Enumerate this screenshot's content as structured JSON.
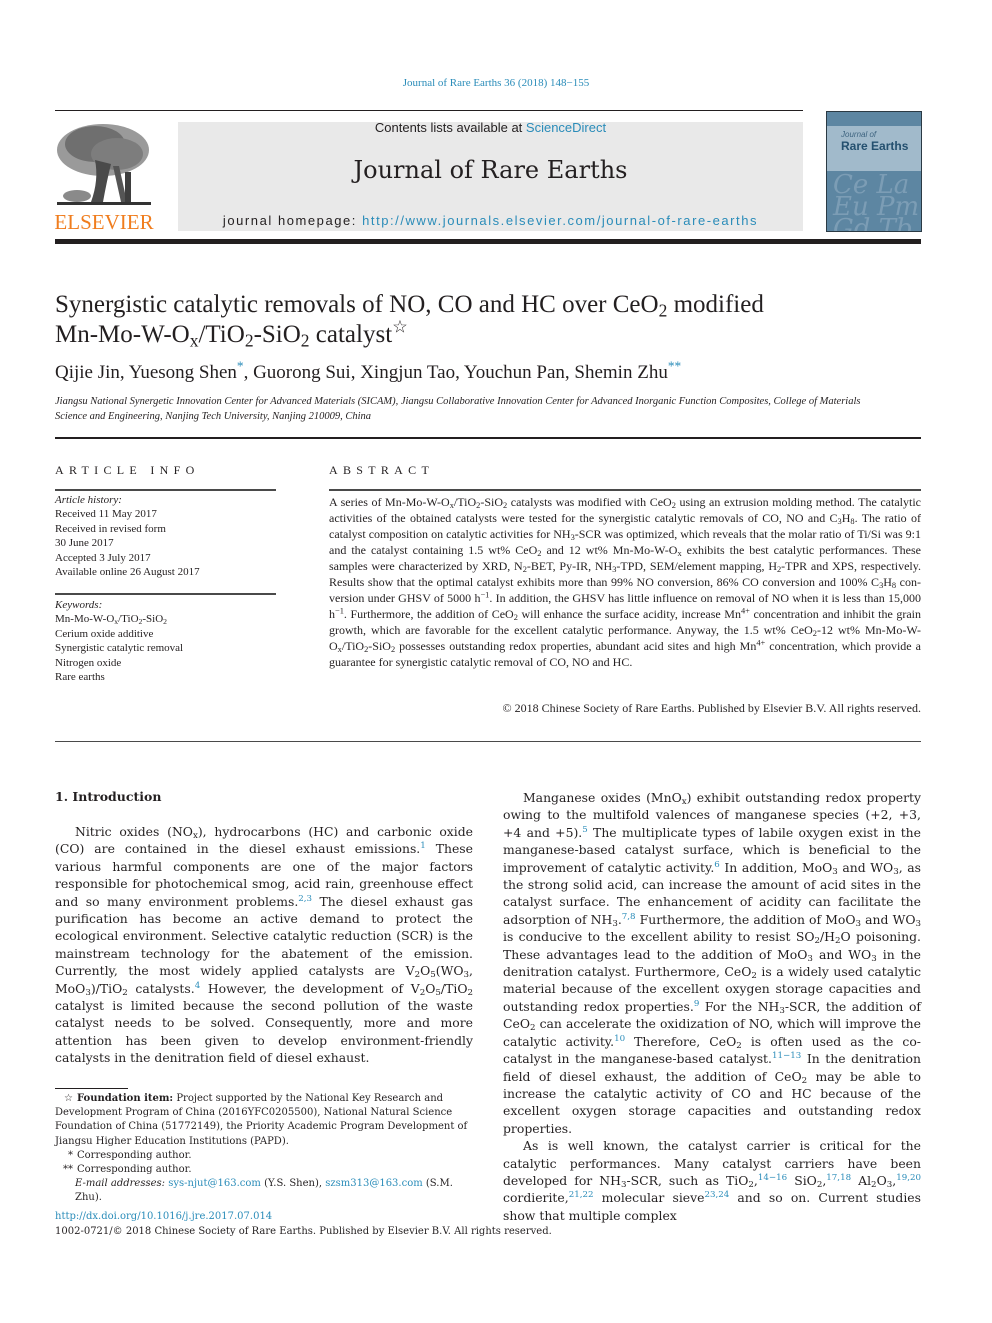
{
  "running_head": "Journal of Rare Earths 36 (2018) 148−155",
  "masthead": {
    "publisher_logo_text": "ELSEVIER",
    "contents_prefix": "Contents lists available at ",
    "contents_link": "ScienceDirect",
    "journal_name": "Journal of Rare Earths",
    "homepage_label": "journal homepage: ",
    "homepage_url": "http://www.journals.elsevier.com/journal-of-rare-earths",
    "cover": {
      "small_title": "Journal of",
      "big_title": "Rare Earths",
      "bg_letters": "Ce La Eu Pm Gd Tb"
    }
  },
  "article": {
    "title_lines": [
      [
        {
          "t": "Synergistic catalytic removals of NO, CO and HC over CeO"
        },
        {
          "t": "2",
          "sub": true
        },
        {
          "t": " modified"
        }
      ],
      [
        {
          "t": "Mn-Mo-W-O"
        },
        {
          "t": "x",
          "sub": true
        },
        {
          "t": "/TiO"
        },
        {
          "t": "2",
          "sub": true
        },
        {
          "t": "-SiO"
        },
        {
          "t": "2",
          "sub": true
        },
        {
          "t": " catalyst"
        },
        {
          "t": "☆",
          "sup": true
        }
      ]
    ],
    "authors": [
      [
        {
          "t": "Qijie Jin, Yuesong Shen"
        },
        {
          "t": "*",
          "sup": true,
          "ref": true
        },
        {
          "t": ", Guorong Sui, Xingjun Tao, Youchun Pan, Shemin Zhu"
        },
        {
          "t": "**",
          "sup": true,
          "ref": true
        }
      ]
    ],
    "affiliation": "Jiangsu National Synergetic Innovation Center for Advanced Materials (SICAM), Jiangsu Collaborative Innovation Center for Advanced Inorganic Function Composites, College of Materials Science and Engineering, Nanjing Tech University, Nanjing 210009, China"
  },
  "article_info": {
    "heading": "ARTICLE INFO",
    "history_label": "Article history:",
    "history": [
      "Received 11 May 2017",
      "Received in revised form",
      "30 June 2017",
      "Accepted 3 July 2017",
      "Available online 26 August 2017"
    ],
    "keywords_label": "Keywords:",
    "keywords": [
      [
        {
          "t": "Mn-Mo-W-O"
        },
        {
          "t": "x",
          "sub": true
        },
        {
          "t": "/TiO"
        },
        {
          "t": "2",
          "sub": true
        },
        {
          "t": "-SiO"
        },
        {
          "t": "2",
          "sub": true
        }
      ],
      [
        {
          "t": "Cerium oxide additive"
        }
      ],
      [
        {
          "t": "Synergistic catalytic removal"
        }
      ],
      [
        {
          "t": "Nitrogen oxide"
        }
      ],
      [
        {
          "t": "Rare earths"
        }
      ]
    ]
  },
  "abstract": {
    "heading": "ABSTRACT",
    "paragraphs": [
      [
        {
          "t": "A series of Mn-Mo-W-O"
        },
        {
          "t": "x",
          "sub": true
        },
        {
          "t": "/TiO"
        },
        {
          "t": "2",
          "sub": true
        },
        {
          "t": "-SiO"
        },
        {
          "t": "2",
          "sub": true
        },
        {
          "t": " catalysts was modified with CeO"
        },
        {
          "t": "2",
          "sub": true
        },
        {
          "t": " using an extrusion molding method. The catalytic activities of the obtained catalysts were tested for the synergistic catalytic re­movals of CO, NO and C"
        },
        {
          "t": "3",
          "sub": true
        },
        {
          "t": "H"
        },
        {
          "t": "8",
          "sub": true
        },
        {
          "t": ". The ratio of catalyst composition on catalytic activities for NH"
        },
        {
          "t": "3",
          "sub": true
        },
        {
          "t": "-SCR was optimized, which reveals that the molar ratio of Ti/Si was 9:1 and the catalyst containing 1.5 wt% CeO"
        },
        {
          "t": "2",
          "sub": true
        },
        {
          "t": " and 12 wt% Mn-Mo-W-O"
        },
        {
          "t": "x",
          "sub": true
        },
        {
          "t": " exhibits the best catalytic performances. These samples were characterized by XRD, N"
        },
        {
          "t": "2",
          "sub": true
        },
        {
          "t": "-BET, Py-IR, NH"
        },
        {
          "t": "3",
          "sub": true
        },
        {
          "t": "-TPD, SEM/element mapping, H"
        },
        {
          "t": "2",
          "sub": true
        },
        {
          "t": "-TPR and XPS, respectively. Results show that the optimal catalyst exhibits more than 99% NO conversion, 86% CO conversion and 100% C"
        },
        {
          "t": "3",
          "sub": true
        },
        {
          "t": "H"
        },
        {
          "t": "8",
          "sub": true
        },
        {
          "t": " con­version under GHSV of 5000 h"
        },
        {
          "t": "−1",
          "sup": true
        },
        {
          "t": ". In addition, the GHSV has little influence on removal of NO when it is less than 15,000 h"
        },
        {
          "t": "−1",
          "sup": true
        },
        {
          "t": ". Furthermore, the addition of CeO"
        },
        {
          "t": "2",
          "sub": true
        },
        {
          "t": " will enhance the surface acidity, increase Mn"
        },
        {
          "t": "4+",
          "sup": true
        },
        {
          "t": " concentration and inhibit the grain growth, which are favorable for the excellent catalytic performance. Anyway, the 1.5 wt% CeO"
        },
        {
          "t": "2",
          "sub": true
        },
        {
          "t": "-12 wt% Mn-Mo-W-O"
        },
        {
          "t": "x",
          "sub": true
        },
        {
          "t": "/TiO"
        },
        {
          "t": "2",
          "sub": true
        },
        {
          "t": "-SiO"
        },
        {
          "t": "2",
          "sub": true
        },
        {
          "t": " possesses outstanding redox properties, abundant acid sites and high Mn"
        },
        {
          "t": "4+",
          "sup": true
        },
        {
          "t": " concentration, which provide a guarantee for synergistic catalytic removal of CO, NO and HC."
        }
      ]
    ],
    "copyright": "© 2018 Chinese Society of Rare Earths. Published by Elsevier B.V. All rights reserved."
  },
  "body": {
    "section_heading": "1.  Introduction",
    "left_paragraphs": [
      [
        {
          "t": "Nitric oxides (NO"
        },
        {
          "t": "x",
          "sub": true
        },
        {
          "t": "), hydrocarbons (HC) and carbonic oxide (CO) are contained in the diesel exhaust emissions."
        },
        {
          "t": "1",
          "sup": true,
          "ref": true
        },
        {
          "t": " These various harmful components are one of the major factors responsible for photochemical smog, acid rain, greenhouse effect and so many environment problems."
        },
        {
          "t": "2,3",
          "sup": true,
          "ref": true
        },
        {
          "t": " The diesel exhaust gas purification has become an active demand to protect the ecological environment. Selective catalytic reduction (SCR) is the mainstream technology for the abatement of the emission. Currently, the most widely applied catalysts are V"
        },
        {
          "t": "2",
          "sub": true
        },
        {
          "t": "O"
        },
        {
          "t": "5",
          "sub": true
        },
        {
          "t": "(WO"
        },
        {
          "t": "3",
          "sub": true
        },
        {
          "t": ", MoO"
        },
        {
          "t": "3",
          "sub": true
        },
        {
          "t": ")/TiO"
        },
        {
          "t": "2",
          "sub": true
        },
        {
          "t": " catalysts."
        },
        {
          "t": "4",
          "sup": true,
          "ref": true
        },
        {
          "t": " However, the development of V"
        },
        {
          "t": "2",
          "sub": true
        },
        {
          "t": "O"
        },
        {
          "t": "5",
          "sub": true
        },
        {
          "t": "/TiO"
        },
        {
          "t": "2",
          "sub": true
        },
        {
          "t": " catalyst is limited because the second pollution of the waste catalyst needs to be solved. Consequently, more and more attention has been given to develop environment-friendly catalysts in the denitration field of diesel exhaust."
        }
      ]
    ],
    "right_paragraphs": [
      [
        {
          "t": "Manganese oxides (MnO"
        },
        {
          "t": "x",
          "sub": true
        },
        {
          "t": ") exhibit outstanding redox property owing to the multifold valences of manganese species (+2, +3, +4 and +5)."
        },
        {
          "t": "5",
          "sup": true,
          "ref": true
        },
        {
          "t": " The multiplicate types of labile oxygen exist in the manganese-based catalyst surface, which is beneficial to the improvement of catalytic activity."
        },
        {
          "t": "6",
          "sup": true,
          "ref": true
        },
        {
          "t": " In addition, MoO"
        },
        {
          "t": "3",
          "sub": true
        },
        {
          "t": " and WO"
        },
        {
          "t": "3",
          "sub": true
        },
        {
          "t": ", as the strong solid acid, can increase the amount of acid sites in the catalyst surface. The enhancement of acidity can facilitate the adsorption of NH"
        },
        {
          "t": "3",
          "sub": true
        },
        {
          "t": "."
        },
        {
          "t": "7,8",
          "sup": true,
          "ref": true
        },
        {
          "t": " Furthermore, the addition of MoO"
        },
        {
          "t": "3",
          "sub": true
        },
        {
          "t": " and WO"
        },
        {
          "t": "3",
          "sub": true
        },
        {
          "t": " is conducive to the excellent ability to resist SO"
        },
        {
          "t": "2",
          "sub": true
        },
        {
          "t": "/H"
        },
        {
          "t": "2",
          "sub": true
        },
        {
          "t": "O poisoning. These advantages lead to the addition of MoO"
        },
        {
          "t": "3",
          "sub": true
        },
        {
          "t": " and WO"
        },
        {
          "t": "3",
          "sub": true
        },
        {
          "t": " in the denitration catalyst. Furthermore, CeO"
        },
        {
          "t": "2",
          "sub": true
        },
        {
          "t": " is a widely used catalytic material because of the excellent oxygen storage capacities and outstanding redox properties."
        },
        {
          "t": "9",
          "sup": true,
          "ref": true
        },
        {
          "t": " For the NH"
        },
        {
          "t": "3",
          "sub": true
        },
        {
          "t": "-SCR, the addition of CeO"
        },
        {
          "t": "2",
          "sub": true
        },
        {
          "t": " can accelerate the oxidization of NO, which will improve the catalytic activity."
        },
        {
          "t": "10",
          "sup": true,
          "ref": true
        },
        {
          "t": " Therefore, CeO"
        },
        {
          "t": "2",
          "sub": true
        },
        {
          "t": " is often used as the co-catalyst in the manganese-based catalyst."
        },
        {
          "t": "11−13",
          "sup": true,
          "ref": true
        },
        {
          "t": " In the denitration field of diesel exhaust, the addition of CeO"
        },
        {
          "t": "2",
          "sub": true
        },
        {
          "t": " may be able to increase the catalytic activity of CO and HC because of the excellent oxygen storage capacities and outstanding redox properties."
        }
      ],
      [
        {
          "t": "As is well known, the catalyst carrier is critical for the catalytic performances. Many catalyst carriers have been developed for NH"
        },
        {
          "t": "3",
          "sub": true
        },
        {
          "t": "-SCR, such as TiO"
        },
        {
          "t": "2",
          "sub": true
        },
        {
          "t": ","
        },
        {
          "t": "14−16",
          "sup": true,
          "ref": true
        },
        {
          "t": " SiO"
        },
        {
          "t": "2",
          "sub": true
        },
        {
          "t": ","
        },
        {
          "t": "17,18",
          "sup": true,
          "ref": true
        },
        {
          "t": " Al"
        },
        {
          "t": "2",
          "sub": true
        },
        {
          "t": "O"
        },
        {
          "t": "3",
          "sub": true
        },
        {
          "t": ","
        },
        {
          "t": "19,20",
          "sup": true,
          "ref": true
        },
        {
          "t": " cordierite,"
        },
        {
          "t": "21,22",
          "sup": true,
          "ref": true
        },
        {
          "t": " molecular sieve"
        },
        {
          "t": "23,24",
          "sup": true,
          "ref": true
        },
        {
          "t": " and so on. Current studies show that multiple complex"
        }
      ]
    ]
  },
  "footnotes": {
    "foundation_marker": "☆",
    "foundation_label": "Foundation item:",
    "foundation_text": " Project supported by the National Key Research and Devel­opment Program of China (2016YFC0205500), National Natural Science Foundation of China (51772149), the Priority Academic Program Development of Jiangsu Higher Education Institutions (PAPD).",
    "corr1_marker": "*",
    "corr1_text": "Corresponding author.",
    "corr2_marker": "**",
    "corr2_text": "Corresponding author.",
    "email_label": "E-mail addresses:",
    "email1": "sys-njut@163.com",
    "email1_owner": " (Y.S. Shen), ",
    "email2": "szsm313@163.com",
    "email2_owner": " (S.M. Zhu)."
  },
  "footer": {
    "doi": "http://dx.doi.org/10.1016/j.jre.2017.07.014",
    "issn_line": "1002-0721/© 2018 Chinese Society of Rare Earths. Published by Elsevier B.V. All rights reserved."
  },
  "colors": {
    "link": "#2a8cb9",
    "elsevier_orange": "#f07d1e",
    "masthead_gray": "#e9e9e9",
    "cover_blue": "#5d86a2"
  }
}
